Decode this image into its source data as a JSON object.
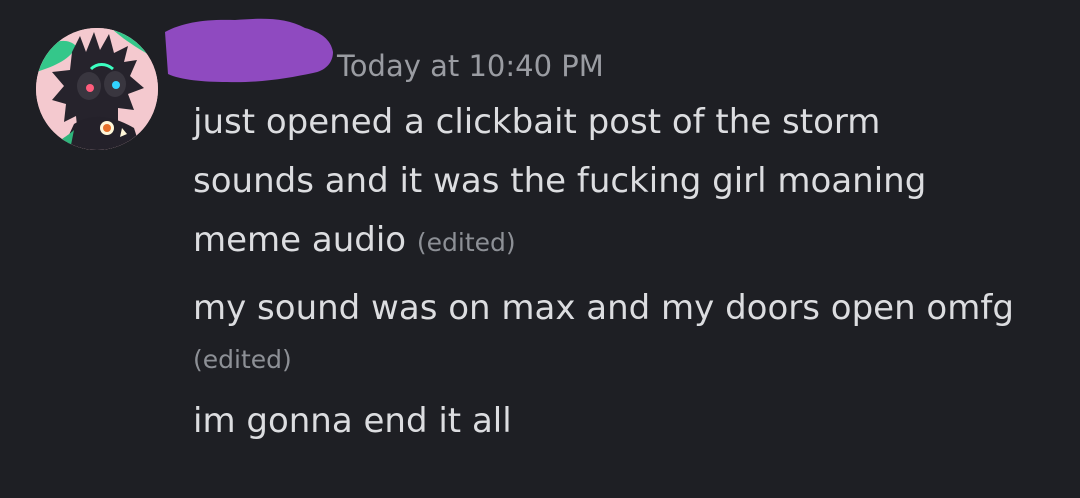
{
  "header": {
    "timestamp": "Today at 10:40 PM"
  },
  "messages": {
    "first": {
      "line1": "just opened a clickbait post of the storm",
      "line2": "sounds and it was the fucking girl moaning",
      "line3": "meme audio",
      "edited": "(edited)"
    },
    "second": {
      "line1": "my sound was on max and my doors open omfg",
      "edited": "(edited)"
    },
    "third": {
      "line1": "im gonna end it all"
    }
  },
  "colors": {
    "background": "#1e1f24",
    "message_text": "#dcdde0",
    "timestamp_text": "#9a9ca2",
    "edited_text": "#8d9096",
    "username_redaction": "#8f4ac0"
  },
  "icons": {
    "avatar": "user-avatar",
    "username": "redacted-username"
  }
}
